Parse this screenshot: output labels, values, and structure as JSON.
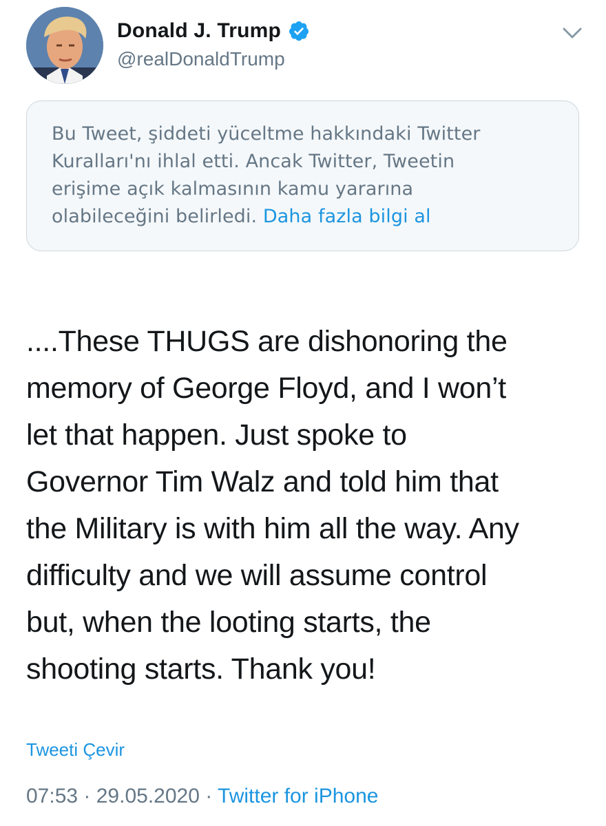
{
  "author": {
    "name": "Donald J. Trump",
    "handle": "@realDonaldTrump",
    "verified_icon": "verified-badge-icon"
  },
  "menu_icon": "chevron-down-icon",
  "notice": {
    "text": "Bu Tweet, şiddeti yüceltme hakkındaki Twitter\nKuralları'nı ihlal etti. Ancak Twitter, Tweetin\nerişime açık kalmasının kamu yararına\nolabileceğini belirledi. ",
    "link": "Daha fazla bilgi al"
  },
  "tweet": {
    "text": "....These THUGS are dishonoring the\nmemory of George Floyd, and I won’t\nlet that happen. Just spoke to\nGovernor Tim Walz and told him that\nthe Military is with him all the way. Any\ndifficulty and we will assume control\nbut, when the looting starts, the\nshooting starts. Thank you!",
    "translate_label": "Tweeti Çevir"
  },
  "meta": {
    "time": "07:53",
    "separator": " · ",
    "date": "29.05.2020",
    "source": "Twitter for iPhone"
  },
  "colors": {
    "link": "#1b95e0",
    "secondary_text": "#657786",
    "notice_bg": "#f5f8fa",
    "notice_border": "#ccd6dd"
  }
}
